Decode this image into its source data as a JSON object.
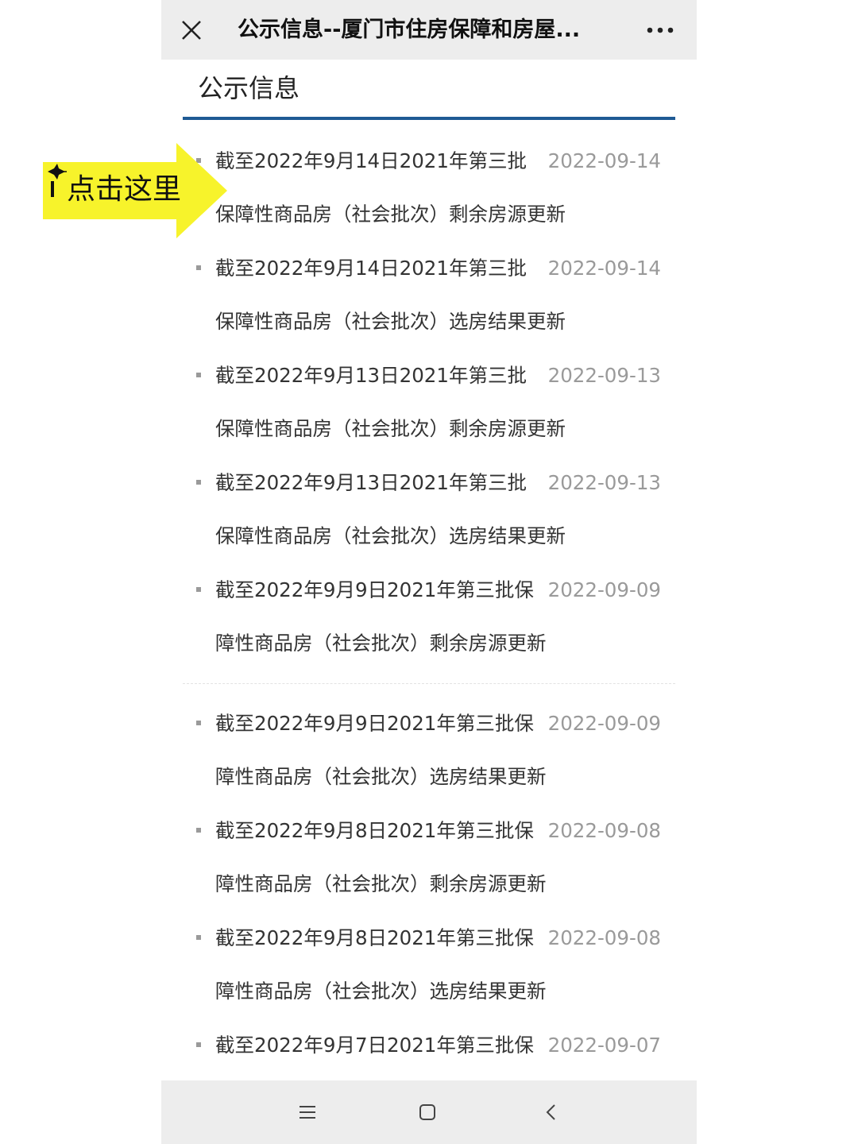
{
  "header": {
    "title": "公示信息--厦门市住房保障和房屋..."
  },
  "section": {
    "title": "公示信息"
  },
  "annotation": {
    "text": "点击这里",
    "color": "#f7f32b"
  },
  "items": [
    {
      "line1": "截至2022年9月14日2021年第三批",
      "line2": "保障性商品房（社会批次）剩余房源更新",
      "date": "2022-09-14"
    },
    {
      "line1": "截至2022年9月14日2021年第三批",
      "line2": "保障性商品房（社会批次）选房结果更新",
      "date": "2022-09-14"
    },
    {
      "line1": "截至2022年9月13日2021年第三批",
      "line2": "保障性商品房（社会批次）剩余房源更新",
      "date": "2022-09-13"
    },
    {
      "line1": "截至2022年9月13日2021年第三批",
      "line2": "保障性商品房（社会批次）选房结果更新",
      "date": "2022-09-13"
    },
    {
      "line1": "截至2022年9月9日2021年第三批保",
      "line2": "障性商品房（社会批次）剩余房源更新",
      "date": "2022-09-09"
    }
  ],
  "items2": [
    {
      "line1": "截至2022年9月9日2021年第三批保",
      "line2": "障性商品房（社会批次）选房结果更新",
      "date": "2022-09-09"
    },
    {
      "line1": "截至2022年9月8日2021年第三批保",
      "line2": "障性商品房（社会批次）剩余房源更新",
      "date": "2022-09-08"
    },
    {
      "line1": "截至2022年9月8日2021年第三批保",
      "line2": "障性商品房（社会批次）选房结果更新",
      "date": "2022-09-08"
    },
    {
      "line1": "截至2022年9月7日2021年第三批保",
      "line2": "",
      "date": "2022-09-07"
    }
  ],
  "icons": {
    "close": "close-icon",
    "more": "more-icon",
    "menu": "menu-icon",
    "home": "home-icon",
    "back": "back-icon"
  },
  "colors": {
    "accent": "#1f5a94",
    "bar": "#ededed",
    "date": "#9a9a9a"
  }
}
